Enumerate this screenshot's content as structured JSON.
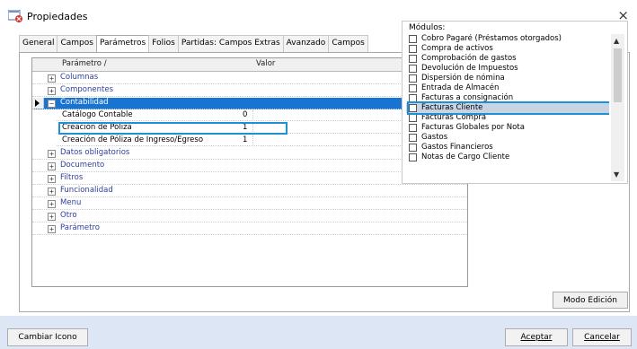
{
  "window": {
    "title": "Propiedades",
    "close_glyph": "×"
  },
  "tabs": [
    {
      "label": "General"
    },
    {
      "label": "Campos"
    },
    {
      "label": "Parámetros"
    },
    {
      "label": "Folios"
    },
    {
      "label": "Partidas: Campos Extras"
    },
    {
      "label": "Avanzado"
    },
    {
      "label": "Campos"
    }
  ],
  "active_tab": "Parámetros",
  "grid": {
    "headers": {
      "parametro": "Parámetro /",
      "valor": "Valor"
    },
    "rows": [
      {
        "type": "group",
        "label": "Columnas",
        "expander": "+"
      },
      {
        "type": "group",
        "label": "Componentes",
        "expander": "+"
      },
      {
        "type": "group",
        "label": "Contabilidad",
        "expander": "−",
        "selected": true
      },
      {
        "type": "param",
        "name": "Catálogo Contable",
        "value": "0"
      },
      {
        "type": "param",
        "name": "Creación de Póliza",
        "value": "1"
      },
      {
        "type": "param",
        "name": "Creación de Póliza de Ingreso/Egreso",
        "value": "1"
      },
      {
        "type": "group",
        "label": "Datos obligatorios",
        "expander": "+"
      },
      {
        "type": "group",
        "label": "Documento",
        "expander": "+"
      },
      {
        "type": "group",
        "label": "Filtros",
        "expander": "+"
      },
      {
        "type": "group",
        "label": "Funcionalidad",
        "expander": "+"
      },
      {
        "type": "group",
        "label": "Menu",
        "expander": "+"
      },
      {
        "type": "group",
        "label": "Otro",
        "expander": "+"
      },
      {
        "type": "group",
        "label": "Parámetro",
        "expander": "+"
      }
    ]
  },
  "modo_edicion_label": "Modo Edición",
  "modulos": {
    "title": "Módulos:",
    "items": [
      {
        "label": "Cobro Pagaré (Préstamos otorgados)"
      },
      {
        "label": "Compra de activos"
      },
      {
        "label": "Comprobación de gastos"
      },
      {
        "label": "Devolución de Impuestos"
      },
      {
        "label": "Dispersión de nómina"
      },
      {
        "label": "Entrada de Almacén"
      },
      {
        "label": "Facturas a consignación"
      },
      {
        "label": "Facturas Cliente",
        "selected": true
      },
      {
        "label": "Facturas Compra"
      },
      {
        "label": "Facturas Globales por Nota"
      },
      {
        "label": "Gastos"
      },
      {
        "label": "Gastos Financieros"
      },
      {
        "label": "Notas de Cargo Cliente"
      }
    ]
  },
  "footer": {
    "cambiar_icono": "Cambiar Icono",
    "aceptar": "Aceptar",
    "cancelar": "Cancelar"
  },
  "colors": {
    "selection": "#1874d0",
    "highlight_box": "#1e90d6",
    "group_text": "#2f3f9f",
    "footer_bg": "#dde6f4"
  }
}
